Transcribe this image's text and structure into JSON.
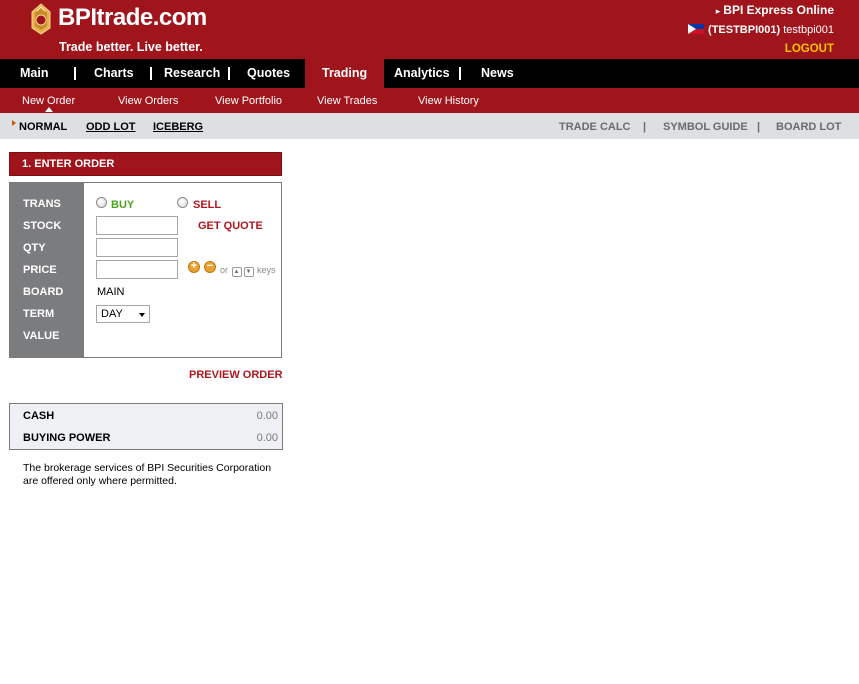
{
  "header": {
    "brand": "BPItrade.com",
    "tagline": "Trade better. Live better.",
    "express_link": "BPI Express Online",
    "user_code": "(TESTBPI001)",
    "user_name": "testbpi001",
    "logout": "LOGOUT",
    "colors": {
      "brand_red": "#a0151c",
      "logout_yellow": "#f5c400"
    }
  },
  "main_nav": {
    "items": [
      "Main",
      "Charts",
      "Research",
      "Quotes",
      "Trading",
      "Analytics",
      "News"
    ],
    "active": "Trading"
  },
  "sub_nav": {
    "items": [
      "New Order",
      "View Orders",
      "View Portfolio",
      "View Trades",
      "View History"
    ],
    "active": "New Order"
  },
  "order_type_nav": {
    "items": [
      "NORMAL",
      "ODD LOT",
      "ICEBERG"
    ],
    "active": "NORMAL"
  },
  "tools_nav": {
    "items": [
      "TRADE CALC",
      "SYMBOL GUIDE",
      "BOARD LOT"
    ],
    "separator": "|"
  },
  "order_form": {
    "title": "1. ENTER ORDER",
    "labels": {
      "trans": "TRANS",
      "stock": "STOCK",
      "qty": "QTY",
      "price": "PRICE",
      "board": "BOARD",
      "term": "TERM",
      "value": "VALUE"
    },
    "buy_label": "BUY",
    "sell_label": "SELL",
    "get_quote": "GET QUOTE",
    "stock_value": "",
    "qty_value": "",
    "price_value": "",
    "price_plus": "+",
    "price_minus": "−",
    "keys_or": "or",
    "keys_label": "keys",
    "board_value": "MAIN",
    "term_value": "DAY",
    "value_value": "",
    "preview_button": "PREVIEW ORDER"
  },
  "account": {
    "cash_label": "CASH",
    "cash_value": "0.00",
    "buying_power_label": "BUYING POWER",
    "buying_power_value": "0.00"
  },
  "disclaimer": "The brokerage services of BPI Securities Corporation are offered only where permitted."
}
